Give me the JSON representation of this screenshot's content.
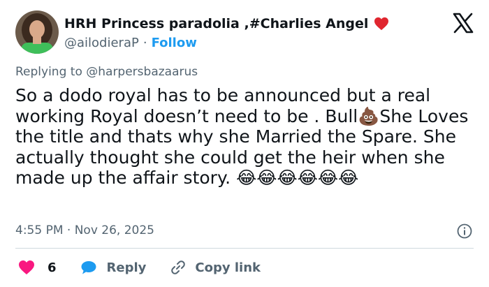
{
  "author": {
    "display_name": "HRH Princess paradolia ,#Charlies Angel",
    "handle": "@ailodieraP",
    "separator": "·",
    "follow_label": "Follow"
  },
  "reply_context": {
    "prefix": "Replying to",
    "mention": "@harpersbazaarus"
  },
  "tweet": {
    "text": "So a dodo royal has to be announced but a real working Royal doesn’t need to be . Bull💩She Loves the title and thats why she Married the Spare. She actually thought she could get the heir when she made up the affair story. 😂😂😂😂😂😂"
  },
  "meta": {
    "timestamp": "4:55 PM · Nov 26, 2025"
  },
  "actions": {
    "likes_count": "6",
    "reply_label": "Reply",
    "copy_link_label": "Copy link"
  },
  "colors": {
    "accent": "#1d9bf0",
    "heart": "#f91880",
    "muted": "#536471",
    "text": "#0f1419"
  },
  "icons": {
    "platform": "x-logo-icon",
    "verified_like": "red-heart-icon",
    "info": "info-icon",
    "like": "heart-icon",
    "reply": "chat-bubble-icon",
    "link": "link-icon"
  }
}
